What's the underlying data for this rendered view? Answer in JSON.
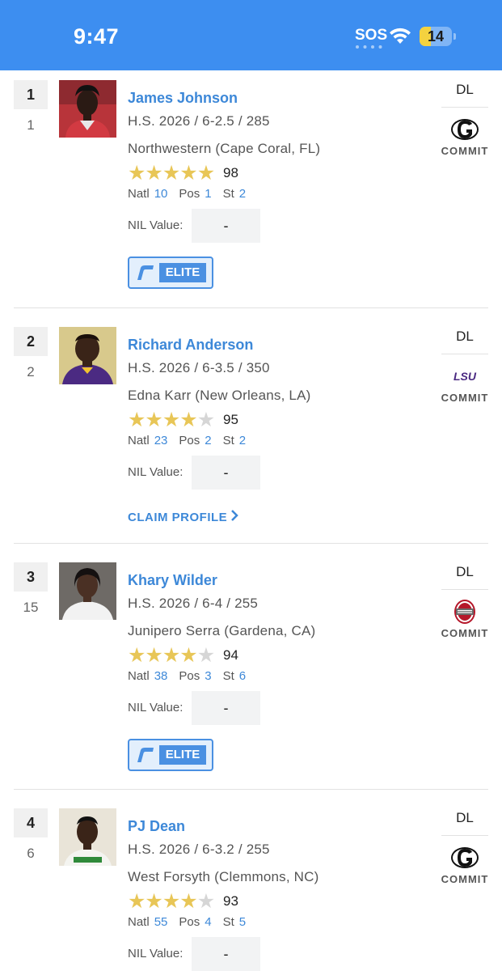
{
  "status_bar": {
    "time": "9:47",
    "sos": "SOS",
    "battery": "14",
    "battery_level_percent": 14,
    "background_color": "#3d8ef0"
  },
  "players": [
    {
      "rank": "1",
      "position_rank": "1",
      "name": "James Johnson",
      "details": "H.S. 2026 / 6-2.5 / 285",
      "school": "Northwestern (Cape Coral, FL)",
      "stars": 5,
      "rating": "98",
      "natl_label": "Natl",
      "natl": "10",
      "pos_label": "Pos",
      "pos": "1",
      "st_label": "St",
      "st": "2",
      "nil_label": "NIL Value:",
      "nil_value": "-",
      "badge": "ELITE",
      "position": "DL",
      "team_logo": "georgia-logo",
      "status": "COMMIT"
    },
    {
      "rank": "2",
      "position_rank": "2",
      "name": "Richard Anderson",
      "details": "H.S. 2026 / 6-3.5 / 350",
      "school": "Edna Karr (New Orleans, LA)",
      "stars": 4,
      "rating": "95",
      "natl_label": "Natl",
      "natl": "23",
      "pos_label": "Pos",
      "pos": "2",
      "st_label": "St",
      "st": "2",
      "nil_label": "NIL Value:",
      "nil_value": "-",
      "claim_label": "CLAIM PROFILE",
      "position": "DL",
      "team_logo": "lsu-logo",
      "team_logo_text": "LSU",
      "status": "COMMIT"
    },
    {
      "rank": "3",
      "position_rank": "15",
      "name": "Khary Wilder",
      "details": "H.S. 2026 / 6-4 / 255",
      "school": "Junipero Serra (Gardena, CA)",
      "stars": 4,
      "rating": "94",
      "natl_label": "Natl",
      "natl": "38",
      "pos_label": "Pos",
      "pos": "3",
      "st_label": "St",
      "st": "6",
      "nil_label": "NIL Value:",
      "nil_value": "-",
      "badge": "ELITE",
      "position": "DL",
      "team_logo": "ohio-state-logo",
      "status": "COMMIT"
    },
    {
      "rank": "4",
      "position_rank": "6",
      "name": "PJ Dean",
      "details": "H.S. 2026 / 6-3.2 / 255",
      "school": "West Forsyth (Clemmons, NC)",
      "stars": 4,
      "rating": "93",
      "natl_label": "Natl",
      "natl": "55",
      "pos_label": "Pos",
      "pos": "4",
      "st_label": "St",
      "st": "5",
      "nil_label": "NIL Value:",
      "nil_value": "-",
      "position": "DL",
      "team_logo": "georgia-logo",
      "status": "COMMIT"
    }
  ],
  "colors": {
    "accent": "#3d88d8",
    "star": "#e8c657",
    "elite_badge": "#4a90e2"
  }
}
